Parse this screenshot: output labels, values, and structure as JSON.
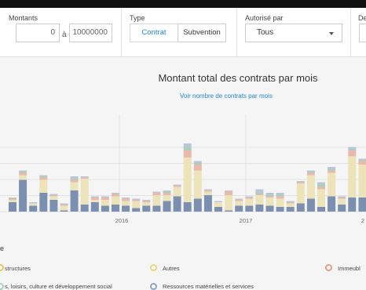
{
  "filters": {
    "montants": {
      "label": "Montants",
      "min_value": "0",
      "separator": "à",
      "max_value": "10000000"
    },
    "type": {
      "label": "Type",
      "options": [
        "Contrat",
        "Subvention"
      ],
      "selected": "Contrat"
    },
    "autorise_par": {
      "label": "Autorisé par",
      "value": "Tous"
    },
    "next_label": "De"
  },
  "main": {
    "title": "Montant total des contrats par mois",
    "toggle_link": "Voir nombre de contrats par mois"
  },
  "chart_data": {
    "type": "bar",
    "stacked": true,
    "title": "Montant total des contrats par mois",
    "x_tick_labels": [
      "2016",
      "2017",
      "2"
    ],
    "grid": true,
    "colors": {
      "blue": "#7b8fb0",
      "cream": "#ece3b9",
      "pink": "#ecb8ab",
      "green": "#a8d2b8",
      "lightblue": "#b8c6dc"
    },
    "series": [
      {
        "name": "blue",
        "values": [
          8,
          27,
          5,
          16,
          10,
          1,
          18,
          6,
          8,
          5,
          6,
          5,
          3,
          5,
          5,
          9,
          13,
          8,
          11,
          14,
          4,
          1,
          5,
          5,
          6,
          5,
          4,
          4,
          7,
          11,
          4,
          13,
          6,
          12,
          12,
          2,
          14,
          6,
          4,
          2
        ]
      },
      {
        "name": "cream",
        "values": [
          2,
          4,
          2,
          11,
          3,
          4,
          7,
          22,
          2,
          5,
          7,
          4,
          6,
          3,
          9,
          5,
          8,
          38,
          24,
          3,
          4,
          13,
          4,
          6,
          8,
          7,
          7,
          3,
          17,
          20,
          15,
          20,
          5,
          35,
          28,
          14,
          18,
          12,
          6,
          3
        ]
      },
      {
        "name": "pink",
        "values": [
          1,
          2,
          0,
          2,
          1,
          1,
          2,
          1,
          2,
          2,
          2,
          2,
          1,
          1,
          2,
          2,
          1,
          6,
          5,
          1,
          0,
          3,
          1,
          1,
          1,
          1,
          2,
          1,
          1,
          2,
          2,
          2,
          1,
          5,
          3,
          2,
          3,
          4,
          2,
          1
        ]
      },
      {
        "name": "green",
        "values": [
          0,
          1,
          0,
          1,
          0,
          0,
          1,
          0,
          0,
          0,
          0,
          0,
          0,
          0,
          0,
          1,
          0,
          3,
          1,
          0,
          0,
          0,
          0,
          0,
          1,
          1,
          1,
          0,
          0,
          1,
          2,
          1,
          0,
          1,
          1,
          0,
          1,
          0,
          0,
          0
        ]
      },
      {
        "name": "lightblue",
        "values": [
          1,
          1,
          1,
          1,
          1,
          1,
          2,
          1,
          1,
          1,
          1,
          1,
          1,
          1,
          1,
          1,
          1,
          3,
          2,
          1,
          1,
          1,
          1,
          1,
          3,
          2,
          2,
          1,
          1,
          1,
          2,
          2,
          1,
          2,
          1,
          1,
          2,
          5,
          3,
          1
        ]
      }
    ]
  },
  "legend": {
    "title": "e",
    "items": [
      {
        "label": "structures",
        "color": "#f0c45a"
      },
      {
        "label": "Autres",
        "color": "#ecd27a"
      },
      {
        "label": "Immeubl",
        "color": "#e89a80"
      },
      {
        "label": "s, loisirs, culture et développement social",
        "color": "#a8d2b8"
      },
      {
        "label": "Ressources matérielles et services",
        "color": "#8da4c6"
      }
    ]
  }
}
